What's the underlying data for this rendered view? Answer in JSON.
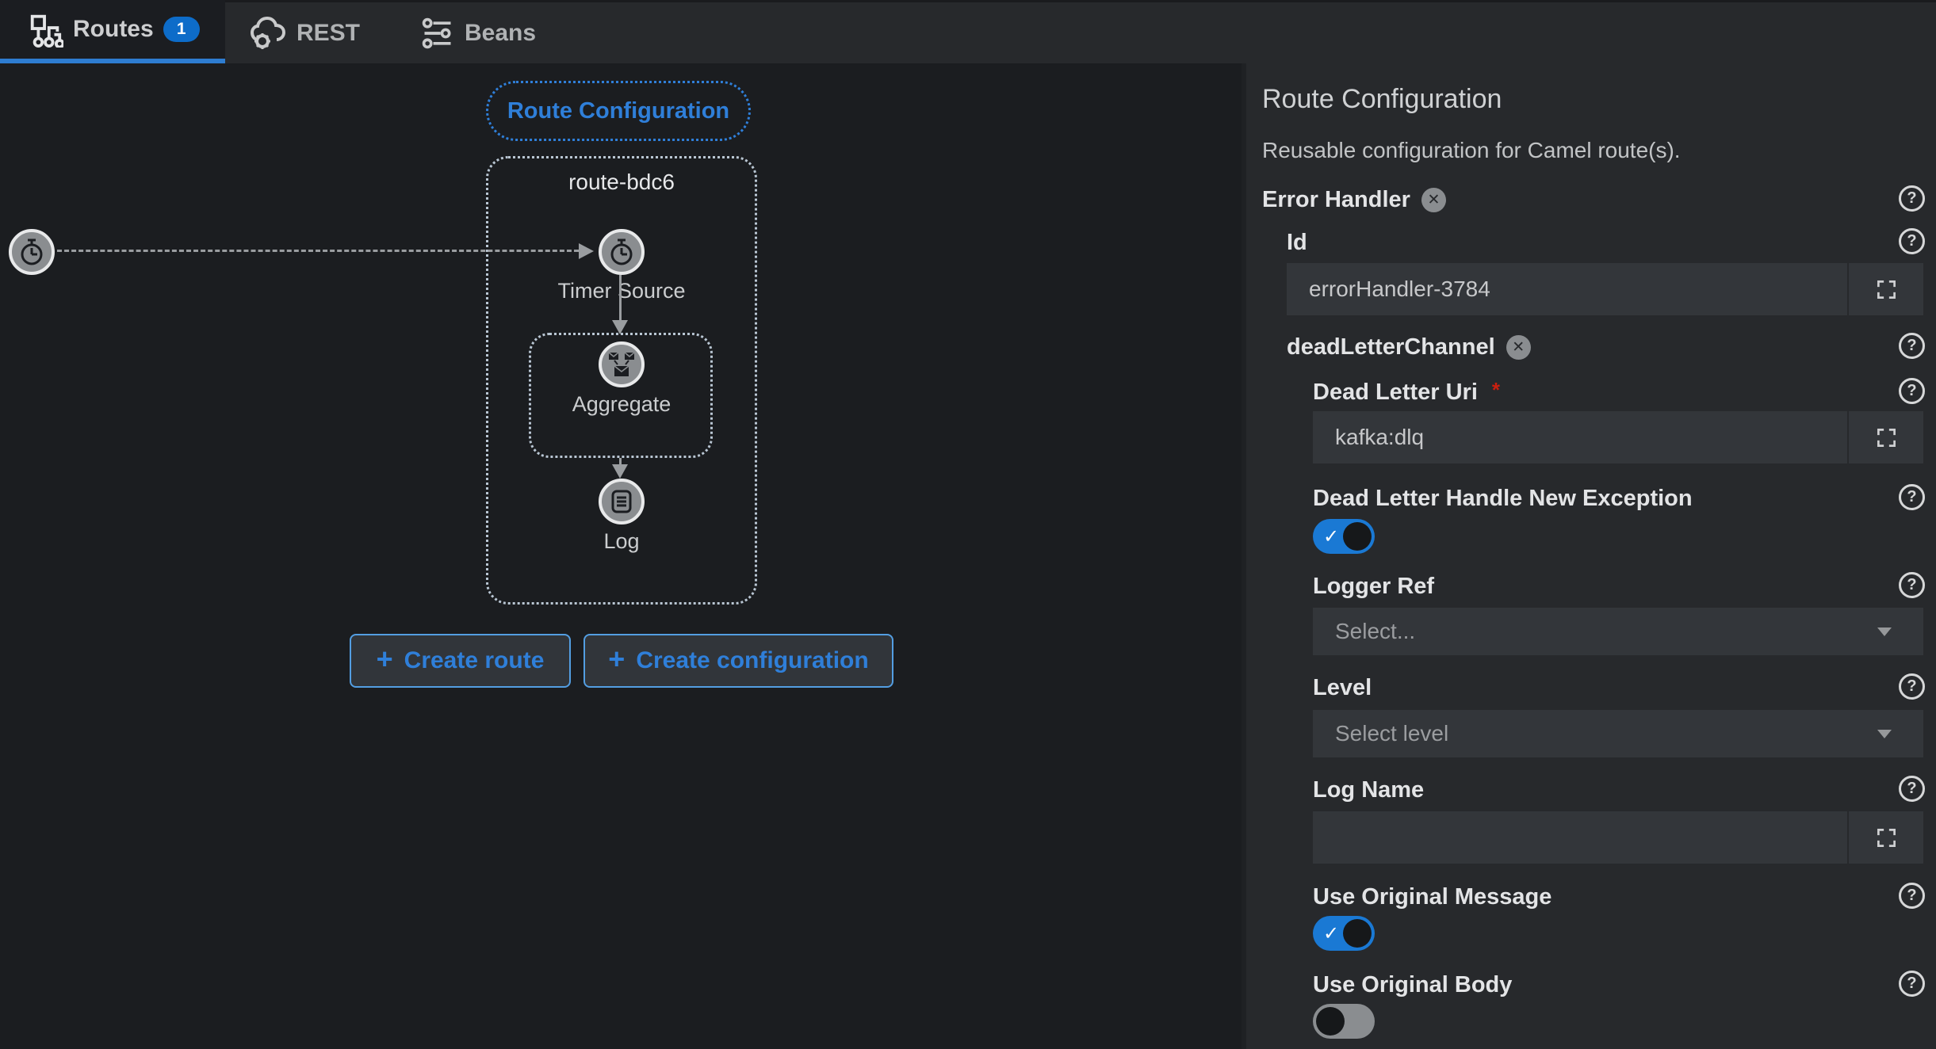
{
  "tabs": {
    "routes": {
      "label": "Routes",
      "badge": "1"
    },
    "rest": {
      "label": "REST"
    },
    "beans": {
      "label": "Beans"
    }
  },
  "canvas": {
    "pill_label": "Route Configuration",
    "route_group_label": "route-bdc6",
    "nodes": {
      "timer": {
        "label": "Timer Source"
      },
      "aggregate": {
        "label": "Aggregate"
      },
      "log": {
        "label": "Log"
      }
    },
    "buttons": {
      "plus": "+",
      "create_route": "Create route",
      "create_configuration": "Create configuration"
    }
  },
  "panel": {
    "title": "Route Configuration",
    "subtitle": "Reusable configuration for Camel route(s).",
    "help_glyph": "?",
    "remove_glyph": "✕",
    "error_handler_label": "Error Handler",
    "fields": {
      "id": {
        "label": "Id",
        "value": "errorHandler-3784"
      },
      "dead_letter_channel": {
        "label": "deadLetterChannel"
      },
      "dead_letter_uri": {
        "label": "Dead Letter Uri",
        "required": "*",
        "value": "kafka:dlq"
      },
      "handle_new_exception": {
        "label": "Dead Letter Handle New Exception",
        "state": "on",
        "check": "✓"
      },
      "logger_ref": {
        "label": "Logger Ref",
        "placeholder": "Select..."
      },
      "level": {
        "label": "Level",
        "placeholder": "Select level"
      },
      "log_name": {
        "label": "Log Name",
        "value": ""
      },
      "use_original_message": {
        "label": "Use Original Message",
        "state": "on",
        "check": "✓"
      },
      "use_original_body": {
        "label": "Use Original Body",
        "state": "off",
        "check": ""
      }
    }
  },
  "colors": {
    "accent_blue": "#2f7fd9",
    "toggle_on_blue": "#1a79d4",
    "badge_blue": "#0d6cc9",
    "canvas_bg": "#1b1d20",
    "panel_bg": "#27292c",
    "field_bg": "#33363a",
    "node_gray": "#8a8d90",
    "required_red": "#cb1f0f"
  }
}
